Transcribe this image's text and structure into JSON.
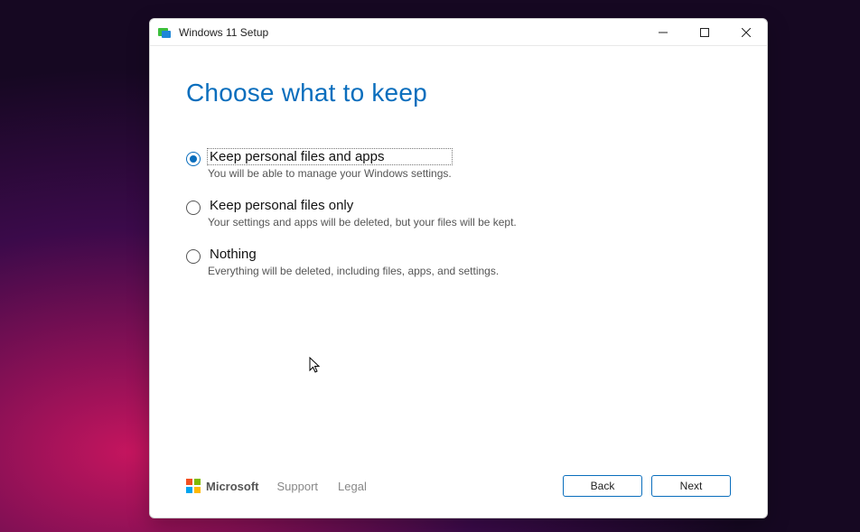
{
  "window": {
    "title": "Windows 11 Setup"
  },
  "heading": "Choose what to keep",
  "options": [
    {
      "label": "Keep personal files and apps",
      "desc": "You will be able to manage your Windows settings.",
      "checked": true
    },
    {
      "label": "Keep personal files only",
      "desc": "Your settings and apps will be deleted, but your files will be kept.",
      "checked": false
    },
    {
      "label": "Nothing",
      "desc": "Everything will be deleted, including files, apps, and settings.",
      "checked": false
    }
  ],
  "footer": {
    "brand": "Microsoft",
    "support": "Support",
    "legal": "Legal",
    "back": "Back",
    "next": "Next"
  }
}
